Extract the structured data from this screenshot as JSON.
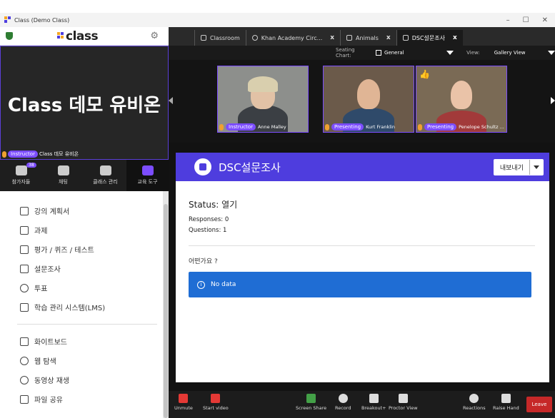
{
  "window": {
    "title": "Class (Demo Class)",
    "controls": [
      "–",
      "☐",
      "✕"
    ]
  },
  "left": {
    "logo": "class",
    "video": {
      "name": "Class 데모 유비온",
      "role": "Instructor",
      "label": "Class 데모 유비온"
    },
    "nav": [
      {
        "label": "참가자들",
        "badge": "38"
      },
      {
        "label": "채팅"
      },
      {
        "label": "클래스 관리"
      },
      {
        "label": "교육 도구"
      }
    ],
    "menu_a": [
      "강의 계획서",
      "과제",
      "평가 / 퀴즈 / 테스트",
      "설문조사",
      "투표",
      "학습 관리 시스템(LMS)"
    ],
    "menu_b": [
      "화이트보드",
      "웹 탐색",
      "동영상 재생",
      "파일 공유"
    ]
  },
  "tabs": [
    {
      "label": "Classroom",
      "closable": false
    },
    {
      "label": "Khan Academy Circ...",
      "closable": true
    },
    {
      "label": "Animals",
      "closable": true
    },
    {
      "label": "DSC설문조사",
      "closable": true,
      "active": true
    }
  ],
  "seating": {
    "label": "Seating Chart:",
    "value": "General",
    "view_label": "View:",
    "view_value": "Gallery View"
  },
  "participants": [
    {
      "role": "Instructor",
      "name": "Anne Malley"
    },
    {
      "role": "Presenting",
      "name": "Kurt Franklin"
    },
    {
      "role": "Presenting",
      "name": "Penelope Schultz ..."
    }
  ],
  "survey": {
    "title": "DSC설문조사",
    "export_label": "내보내기",
    "status": "Status: 열기",
    "responses": "Responses: 0",
    "questions": "Questions: 1",
    "question_text": "어떤가요 ?",
    "nodata": "No data"
  },
  "toolbar": {
    "unmute": "Unmute",
    "start_video": "Start video",
    "screen_share": "Screen Share",
    "record": "Record",
    "breakout": "Breakout+",
    "proctor": "Proctor View",
    "reactions": "Reactions",
    "raise_hand": "Raise Hand",
    "leave": "Leave"
  },
  "colors": {
    "accent": "#4e3dde",
    "purple": "#7c4dff",
    "info_blue": "#1f6dd4",
    "leave_red": "#c62828"
  }
}
